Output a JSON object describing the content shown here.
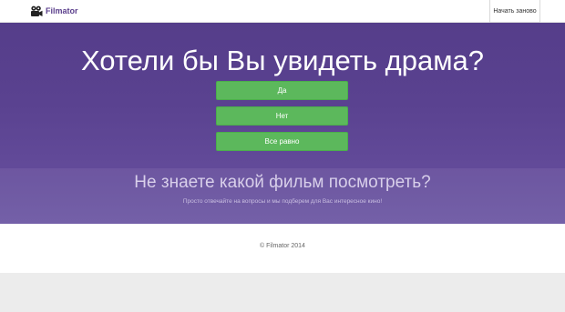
{
  "navbar": {
    "brand": "Filmator",
    "brand_icon": "film-camera-icon",
    "restart_label": "Начать заново"
  },
  "hero": {
    "question": "Хотели бы Вы увидеть драма?",
    "answers": [
      {
        "label": "Да"
      },
      {
        "label": "Нет"
      },
      {
        "label": "Все равно"
      }
    ],
    "tagline": "Не знаете какой фильм посмотреть?",
    "subtitle": "Просто отвечайте на вопросы и мы подберем для Вас интересное кино!"
  },
  "footer": {
    "copyright": "© Filmator 2014"
  },
  "colors": {
    "brand": "#5b3f8c",
    "hero_background": "#5a4290",
    "answer_button": "#5cb85c"
  }
}
